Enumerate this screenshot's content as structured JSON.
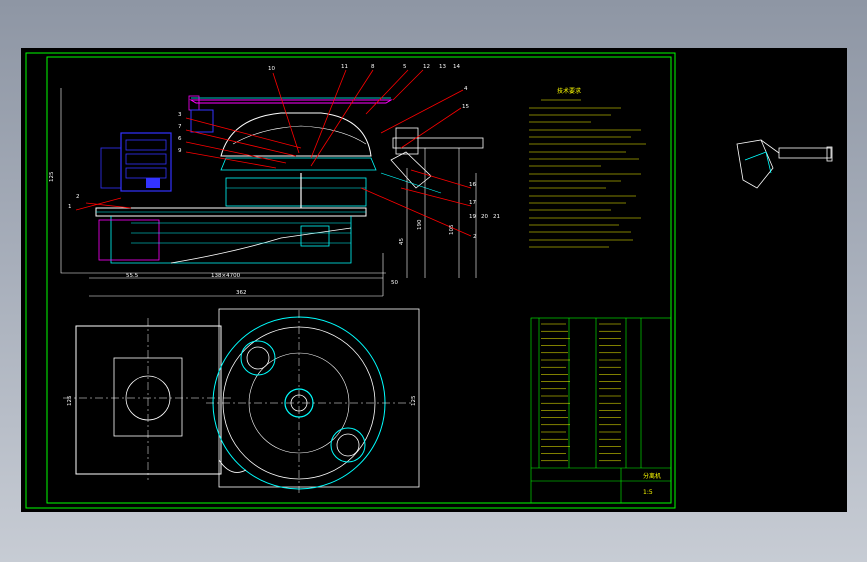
{
  "colors": {
    "background": "#000000",
    "frame": "#00ff00",
    "outline": "#ffffff",
    "leader": "#ff0000",
    "hidden": "#ff00ff",
    "part": "#00ffff",
    "motor": "#3333ff",
    "notes": "#ffff00"
  },
  "callouts": {
    "top_row": [
      "10",
      "11",
      "8",
      "5",
      "12",
      "13",
      "14",
      "4",
      "15"
    ],
    "left_col": [
      "3",
      "7",
      "6",
      "9",
      "1",
      "2"
    ],
    "right_col": [
      "16",
      "17",
      "2",
      "19",
      "20",
      "21"
    ]
  },
  "dimensions": {
    "width_total": "362",
    "width_base": "138×4700",
    "offset": "55.5",
    "side": "50",
    "height_left": "125",
    "height_a": "190",
    "height_b": "105",
    "height_c": "45",
    "plan_left": "125",
    "plan_right": "125"
  },
  "notes": {
    "title": "技术要求"
  },
  "title_block": {
    "drawing_title": "分离机",
    "scale": "1:5"
  }
}
